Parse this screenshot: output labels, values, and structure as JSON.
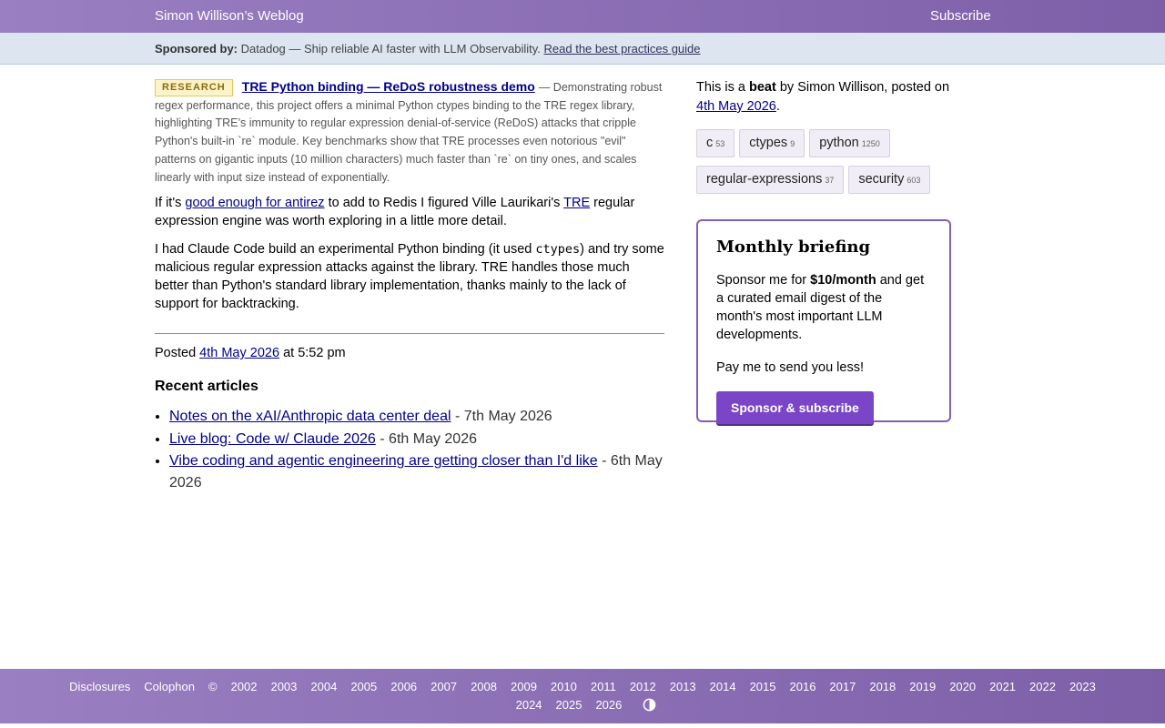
{
  "header": {
    "site_title": "Simon Willison’s Weblog",
    "subscribe": "Subscribe"
  },
  "sponsor_bar": {
    "label": "Sponsored by:",
    "text": "Datadog — Ship reliable AI faster with LLM Observability.",
    "link": "Read the best practices guide"
  },
  "beat": {
    "badge": "RESEARCH",
    "title": "TRE Python binding — ReDoS robustness demo",
    "description": "— Demonstrating robust regex performance, this project offers a minimal Python ctypes binding to the TRE regex library, highlighting TRE’s immunity to regular expression denial-of-service (ReDoS) attacks that cripple Python's built-in `re` module. Key benchmarks show that TRE processes even notorious \"evil\" patterns on gigantic inputs (10 million characters) much faster than `re` on tiny ones, and scales linearly with input size instead of exponentially."
  },
  "para1": {
    "t1": "If it's ",
    "link1": "good enough for antirez",
    "t2": " to add to Redis I figured Ville Laurikari's ",
    "link2": "TRE",
    "t3": " regular expression engine was worth exploring in a little more detail."
  },
  "para2": {
    "t1": "I had Claude Code build an experimental Python binding (it used ",
    "code": "ctypes",
    "t2": ") and try some malicious regular expression attacks against the library. TRE handles those much better than Python's standard library implementation, thanks mainly to the lack of support for backtracking."
  },
  "posted": {
    "prefix": "Posted ",
    "date": "4th May 2026",
    "suffix": " at 5:52 pm"
  },
  "recent": {
    "heading": "Recent articles",
    "items": [
      {
        "title": "Notes on the xAI/Anthropic data center deal",
        "date": " - 7th May 2026"
      },
      {
        "title": "Live blog: Code w/ Claude 2026",
        "date": " - 6th May 2026"
      },
      {
        "title": "Vibe coding and agentic engineering are getting closer than I'd like",
        "date": " - 6th May 2026"
      }
    ]
  },
  "sidebar": {
    "intro_t1": "This is a ",
    "intro_bold": "beat",
    "intro_t2": " by Simon Willison, posted on ",
    "intro_date": "4th May 2026",
    "intro_end": ".",
    "tags": [
      {
        "name": "c",
        "count": "53"
      },
      {
        "name": "ctypes",
        "count": "9"
      },
      {
        "name": "python",
        "count": "1250"
      },
      {
        "name": "regular-expressions",
        "count": "37"
      },
      {
        "name": "security",
        "count": "603"
      }
    ]
  },
  "briefing": {
    "title": "Monthly briefing",
    "p1_t1": "Sponsor me for ",
    "p1_bold": "$10/month",
    "p1_t2": " and get a curated email digest of the month's most important LLM developments.",
    "p2": "Pay me to send you less!",
    "button": "Sponsor & subscribe"
  },
  "footer": {
    "links": [
      "Disclosures",
      "Colophon",
      "©",
      "2002",
      "2003",
      "2004",
      "2005",
      "2006",
      "2007",
      "2008",
      "2009",
      "2010",
      "2011",
      "2012",
      "2013",
      "2014",
      "2015",
      "2016",
      "2017",
      "2018",
      "2019",
      "2020",
      "2021",
      "2022",
      "2023"
    ],
    "links_row2": [
      "2024",
      "2025",
      "2026"
    ],
    "theme_icon": "contrast-icon"
  },
  "colors": {
    "header_bg": "#8a6db5",
    "link": "#00008b",
    "accent": "#7a45c6",
    "sponsor_bg": "#dde5f0"
  }
}
